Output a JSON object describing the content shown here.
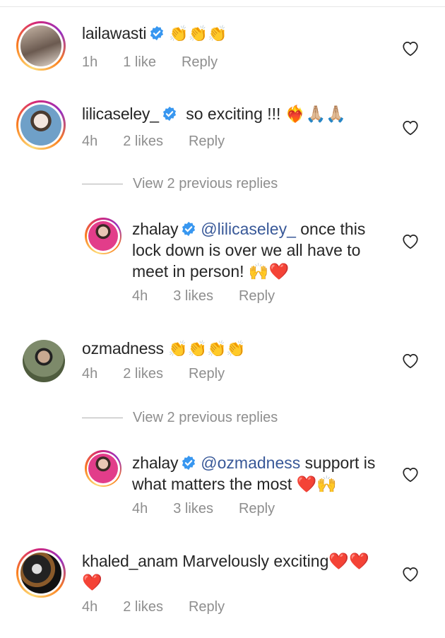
{
  "comments": [
    {
      "user": "lailawasti",
      "text": "👏👏👏",
      "time": "1h",
      "likes": "1 like",
      "reply": "Reply"
    },
    {
      "user": "lilicaseley_",
      "text": "so exciting !!! ❤️‍🔥🙏🏼🙏🏼",
      "time": "4h",
      "likes": "2 likes",
      "reply": "Reply"
    },
    {
      "user": "ozmadness",
      "text": "👏👏👏👏",
      "time": "4h",
      "likes": "2 likes",
      "reply": "Reply"
    },
    {
      "user": "khaled_anam",
      "text": "Marvelously exciting❤️❤️❤️",
      "time": "4h",
      "likes": "2 likes",
      "reply": "Reply"
    }
  ],
  "view_replies": [
    "View 2 previous replies",
    "View 2 previous replies"
  ],
  "replies": [
    {
      "user": "zhalay",
      "mention": "@lilicaseley_",
      "text": " once this lock down is over we all have to meet in person! 🙌❤️",
      "time": "4h",
      "likes": "3 likes",
      "reply": "Reply"
    },
    {
      "user": "zhalay",
      "mention": "@ozmadness",
      "text": " support is what matters the most ❤️🙌",
      "time": "4h",
      "likes": "3 likes",
      "reply": "Reply"
    }
  ],
  "colors": {
    "verified": "#3897f0",
    "meta": "#8e8e8e",
    "mention": "#385898"
  },
  "icons": {
    "verified": "verified-badge-icon",
    "like": "heart-outline-icon"
  }
}
